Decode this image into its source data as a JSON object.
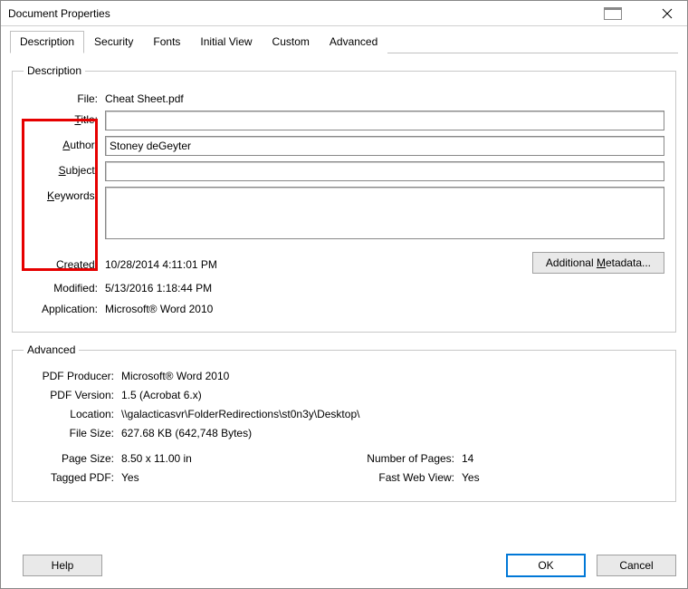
{
  "window": {
    "title": "Document Properties"
  },
  "tabs": {
    "description": "Description",
    "security": "Security",
    "fonts": "Fonts",
    "initialView": "Initial View",
    "custom": "Custom",
    "advanced": "Advanced"
  },
  "descGroup": {
    "legend": "Description",
    "fileLabel": "File:",
    "fileValue": "Cheat Sheet.pdf",
    "titleLabel_pre": "T",
    "titleLabel_post": "itle:",
    "titleValue": "",
    "authorLabel_pre": "A",
    "authorLabel_post": "uthor:",
    "authorValue": "Stoney deGeyter",
    "subjectLabel_pre": "S",
    "subjectLabel_post": "ubject:",
    "subjectValue": "",
    "keywordsLabel_pre": "K",
    "keywordsLabel_post": "eywords:",
    "keywordsValue": "",
    "createdLabel": "Created:",
    "createdValue": "10/28/2014 4:11:01 PM",
    "modifiedLabel": "Modified:",
    "modifiedValue": "5/13/2016 1:18:44 PM",
    "applicationLabel": "Application:",
    "applicationValue": "Microsoft® Word 2010",
    "additionalMetadata_pre": "Additional ",
    "additionalMetadata_u": "M",
    "additionalMetadata_post": "etadata..."
  },
  "advGroup": {
    "legend": "Advanced",
    "producerLabel": "PDF Producer:",
    "producerValue": "Microsoft® Word 2010",
    "versionLabel": "PDF Version:",
    "versionValue": "1.5 (Acrobat 6.x)",
    "locationLabel": "Location:",
    "locationValue": "\\\\galacticasvr\\FolderRedirections\\st0n3y\\Desktop\\",
    "fileSizeLabel": "File Size:",
    "fileSizeValue": "627.68 KB (642,748 Bytes)",
    "pageSizeLabel": "Page Size:",
    "pageSizeValue": "8.50 x 11.00 in",
    "numPagesLabel": "Number of Pages:",
    "numPagesValue": "14",
    "taggedLabel": "Tagged PDF:",
    "taggedValue": "Yes",
    "fastWebLabel": "Fast Web View:",
    "fastWebValue": "Yes"
  },
  "buttons": {
    "help": "Help",
    "ok": "OK",
    "cancel": "Cancel"
  }
}
